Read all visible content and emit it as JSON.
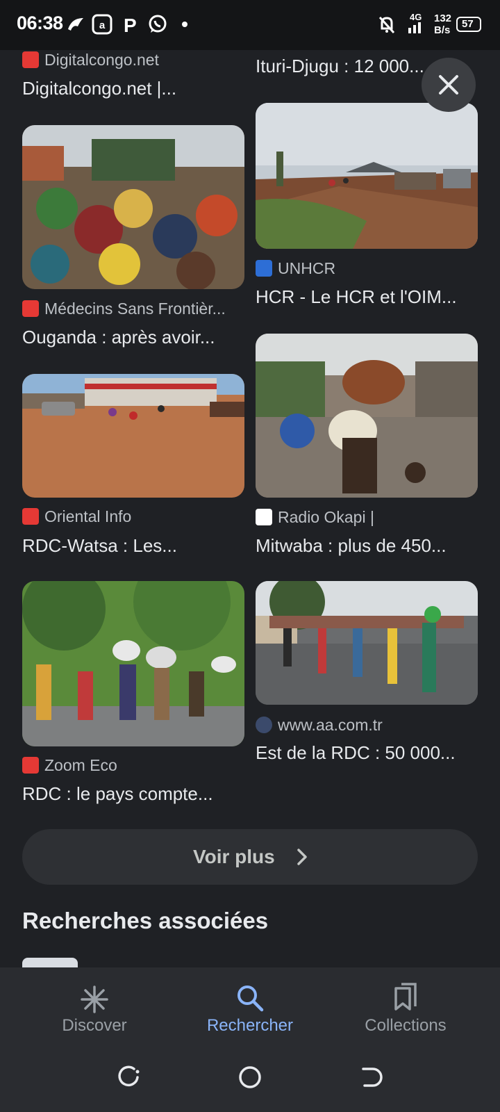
{
  "status": {
    "time": "06:38",
    "network": "4G",
    "speed_value": "132",
    "speed_unit": "B/s",
    "battery": "57"
  },
  "top_row": {
    "left_source": "Digitalcongo.net",
    "left_title": "Digitalcongo.net |...",
    "right_title": "Ituri-Djugu : 12 000..."
  },
  "results": [
    {
      "source": "UNHCR",
      "title": "HCR - Le HCR et l'OIM...",
      "favicon_color": "#2d6ed6"
    },
    {
      "source": "Médecins Sans Frontièr...",
      "title": "Ouganda : après avoir...",
      "favicon_color": "#e53935"
    },
    {
      "source": "Oriental Info",
      "title": "RDC-Watsa : Les...",
      "favicon_color": "#e53935"
    },
    {
      "source": "Radio Okapi |",
      "title": "Mitwaba : plus de 450...",
      "favicon_color": "#ffffff"
    },
    {
      "source": "Zoom Eco",
      "title": "RDC : le pays compte...",
      "favicon_color": "#e53935"
    },
    {
      "source": "www.aa.com.tr",
      "title": "Est de la RDC : 50 000...",
      "favicon_color": "#3b4a6b"
    }
  ],
  "more_button": {
    "label": "Voir plus"
  },
  "related": {
    "title": "Recherches associées"
  },
  "nav": {
    "items": [
      {
        "label": "Discover",
        "icon": "asterisk-icon"
      },
      {
        "label": "Rechercher",
        "icon": "search-icon"
      },
      {
        "label": "Collections",
        "icon": "bookmarks-icon"
      }
    ],
    "active_color": "#8ab4f8"
  }
}
